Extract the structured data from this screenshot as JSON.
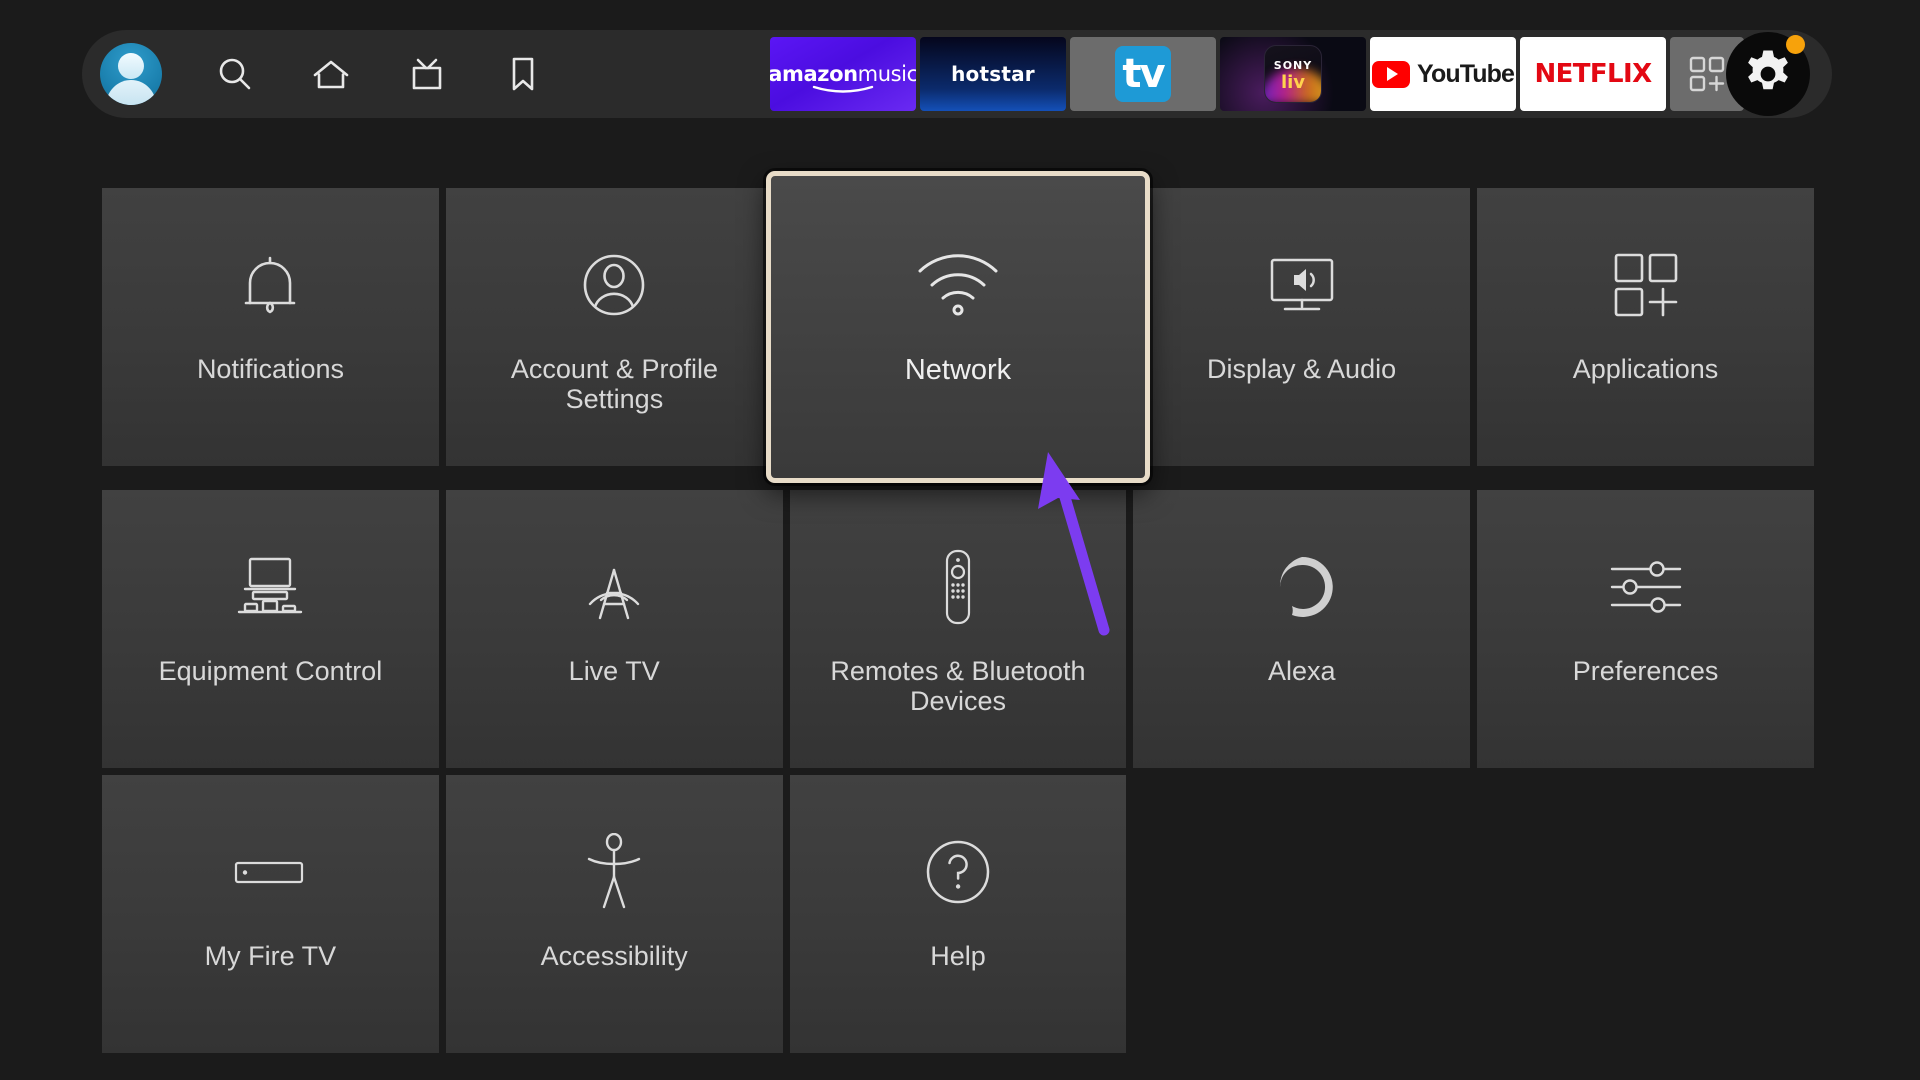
{
  "screen": {
    "title": "Fire TV Settings",
    "background_color": "#1b1b1b"
  },
  "colors": {
    "tile_bg": "#3a3a3a",
    "focus_border": "#e8dcc8",
    "annotation_arrow": "#7c3cf0",
    "notification_dot": "#f7a20b",
    "avatar_blue": "#1a7fad",
    "netflix_red": "#e30813",
    "youtube_red": "#ff0000"
  },
  "topbar": {
    "avatar": {
      "name": "profile-avatar",
      "label": "Profile"
    },
    "nav_items": [
      {
        "icon": "search-icon",
        "label": "Search"
      },
      {
        "icon": "home-icon",
        "label": "Home"
      },
      {
        "icon": "live-tv-icon",
        "label": "Live"
      },
      {
        "icon": "bookmark-icon",
        "label": "Watchlist"
      }
    ],
    "apps": [
      {
        "id": "amazon-music",
        "name": "amazon music",
        "word1": "amazon",
        "word2": "music"
      },
      {
        "id": "hotstar",
        "name": "hotstar",
        "word1": "hotstar"
      },
      {
        "id": "apple-tv",
        "name": "Apple TV",
        "word1": "tv"
      },
      {
        "id": "sony-liv",
        "name": "SonyLIV",
        "word1": "SONY",
        "word2": "liv"
      },
      {
        "id": "youtube",
        "name": "YouTube",
        "word1": "YouTube"
      },
      {
        "id": "netflix",
        "name": "NETFLIX",
        "word1": "NETFLIX"
      },
      {
        "id": "app-library",
        "name": "apps-grid-add",
        "word1": ""
      }
    ],
    "settings_button": {
      "icon": "gear-icon",
      "label": "Settings",
      "has_notification": true
    }
  },
  "grid": {
    "rows": [
      [
        {
          "id": "notifications",
          "label": "Notifications",
          "icon": "bell-icon",
          "focused": false
        },
        {
          "id": "account-profile-settings",
          "label": "Account & Profile Settings",
          "icon": "person-circle-icon",
          "focused": false
        },
        {
          "id": "network",
          "label": "Network",
          "icon": "wifi-icon",
          "focused": true
        },
        {
          "id": "display-audio",
          "label": "Display & Audio",
          "icon": "tv-speaker-icon",
          "focused": false
        },
        {
          "id": "applications",
          "label": "Applications",
          "icon": "apps-grid-icon",
          "focused": false
        }
      ],
      [
        {
          "id": "equipment-control",
          "label": "Equipment Control",
          "icon": "monitor-equipment-icon",
          "focused": false
        },
        {
          "id": "live-tv",
          "label": "Live TV",
          "icon": "antenna-icon",
          "focused": false
        },
        {
          "id": "remotes-bluetooth-devices",
          "label": "Remotes & Bluetooth Devices",
          "icon": "remote-icon",
          "focused": false
        },
        {
          "id": "alexa",
          "label": "Alexa",
          "icon": "alexa-ring-icon",
          "focused": false
        },
        {
          "id": "preferences",
          "label": "Preferences",
          "icon": "sliders-icon",
          "focused": false
        }
      ],
      [
        {
          "id": "my-fire-tv",
          "label": "My Fire TV",
          "icon": "fire-tv-stick-icon",
          "focused": false
        },
        {
          "id": "accessibility",
          "label": "Accessibility",
          "icon": "accessibility-icon",
          "focused": false
        },
        {
          "id": "help",
          "label": "Help",
          "icon": "question-circle-icon",
          "focused": false
        },
        {
          "id": "blank-1",
          "label": "",
          "icon": "",
          "focused": false
        },
        {
          "id": "blank-2",
          "label": "",
          "icon": "",
          "focused": false
        }
      ]
    ]
  },
  "annotation": {
    "arrow": {
      "name": "pointer-arrow",
      "points_to": "network",
      "color": "#7c3cf0"
    }
  }
}
